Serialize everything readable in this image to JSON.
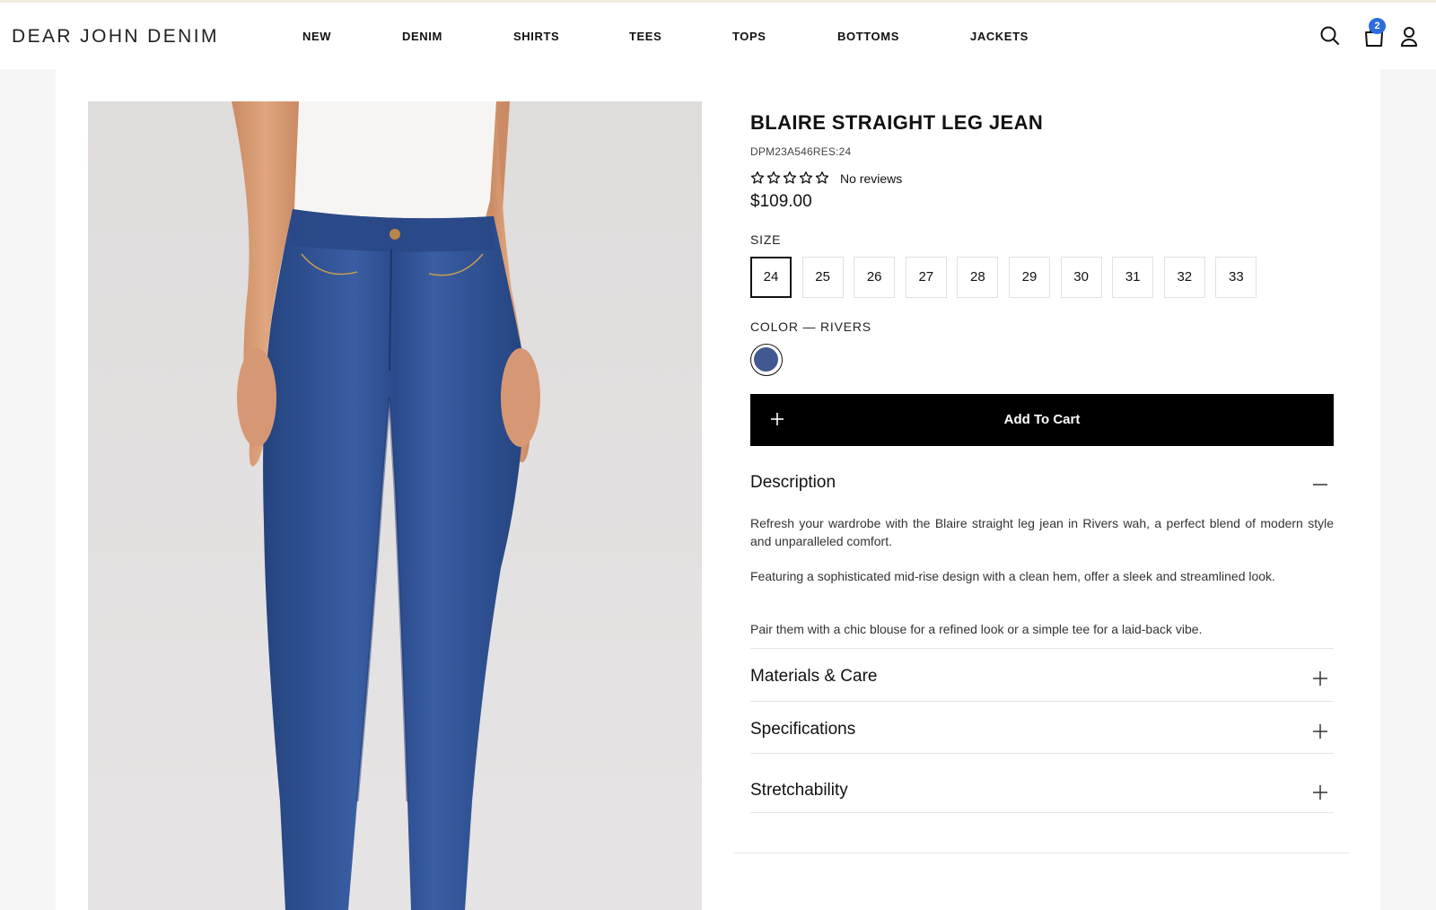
{
  "brand": {
    "logo": "DEAR JOHN DENIM"
  },
  "nav": {
    "items": [
      {
        "label": "NEW"
      },
      {
        "label": "DENIM"
      },
      {
        "label": "SHIRTS"
      },
      {
        "label": "TEES"
      },
      {
        "label": "TOPS"
      },
      {
        "label": "BOTTOMS"
      },
      {
        "label": "JACKETS"
      }
    ]
  },
  "header_icons": {
    "search": "search-icon",
    "cart": "shopping-bag-icon",
    "cart_count": "2",
    "account": "user-icon"
  },
  "product": {
    "image": "product-photo",
    "title": "BLAIRE STRAIGHT LEG JEAN",
    "sku": "DPM23A546RES:24",
    "rating": 0,
    "reviews_text": "No reviews",
    "price": "$109.00",
    "size_label": "SIZE",
    "sizes": [
      "24",
      "25",
      "26",
      "27",
      "28",
      "29",
      "30",
      "31",
      "32",
      "33"
    ],
    "selected_size": "24",
    "color_label": "COLOR — RIVERS",
    "color_swatch": "#415890",
    "add_to_cart": "Add To Cart"
  },
  "accordion": {
    "description": {
      "title": "Description",
      "expanded": true,
      "paragraphs": [
        "Refresh your wardrobe with the Blaire straight leg jean in Rivers wah, a perfect blend of modern style and unparalleled comfort.",
        "Featuring a sophisticated mid-rise design with a clean hem, offer a sleek and streamlined look.",
        "Pair them with a chic blouse for a refined look or a simple tee for a laid-back vibe."
      ]
    },
    "materials": {
      "title": "Materials & Care",
      "expanded": false
    },
    "specifications": {
      "title": "Specifications",
      "expanded": false
    },
    "stretchability": {
      "title": "Stretchability",
      "expanded": false
    }
  },
  "colors": {
    "accent_badge": "#2d6cdf",
    "button_bg": "#000000",
    "denim": "#2e4d8f"
  }
}
